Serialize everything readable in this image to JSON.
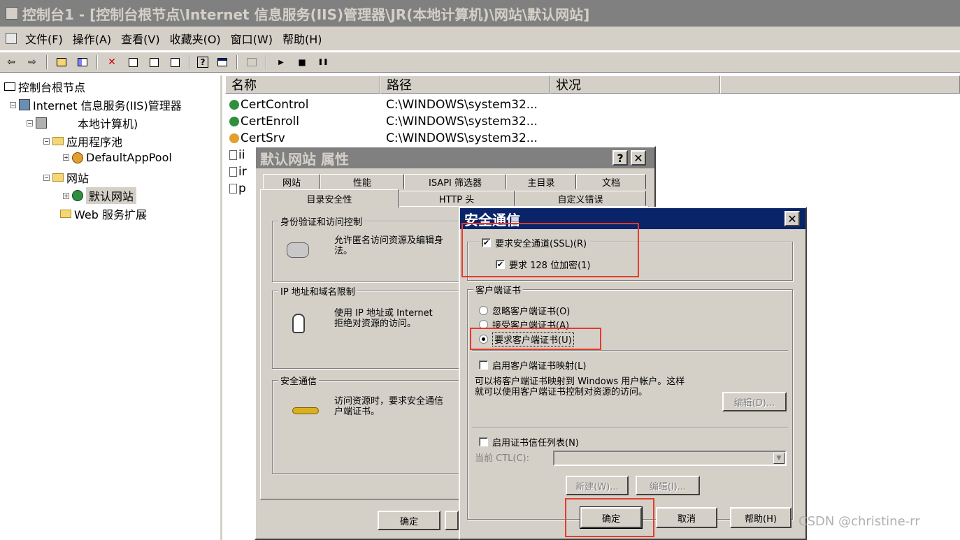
{
  "app": {
    "title": "控制台1 - [控制台根节点\\Internet 信息服务(IIS)管理器\\JR(本地计算机)\\网站\\默认网站]"
  },
  "menu": [
    "文件(F)",
    "操作(A)",
    "查看(V)",
    "收藏夹(O)",
    "窗口(W)",
    "帮助(H)"
  ],
  "toolbar": {
    "icons": [
      "back-icon",
      "forward-icon",
      "up-icon",
      "show-hide-tree-icon",
      "delete-icon",
      "properties-icon",
      "refresh-icon",
      "export-icon",
      "help-icon",
      "view-icon",
      "computer-icon",
      "play-icon",
      "stop-icon",
      "pause-icon"
    ],
    "glyphs": {
      "back": "⇦",
      "forward": "⇨",
      "delete": "✕",
      "help": "?",
      "play": "▶",
      "stop": "■",
      "pause": "❚❚"
    }
  },
  "tree": {
    "root": "控制台根节点",
    "iis": "Internet 信息服务(IIS)管理器",
    "computer": "本地计算机)",
    "apppools": "应用程序池",
    "defaultpool": "DefaultAppPool",
    "websites": "网站",
    "defaultsite": "默认网站",
    "webext": "Web 服务扩展",
    "plus": "+",
    "minus": "−"
  },
  "list": {
    "columns": [
      "名称",
      "路径",
      "状况"
    ],
    "rows": [
      {
        "name": "CertControl",
        "path": "C:\\WINDOWS\\system32..."
      },
      {
        "name": "CertEnroll",
        "path": "C:\\WINDOWS\\system32..."
      },
      {
        "name": "CertSrv",
        "path": "C:\\WINDOWS\\system32..."
      },
      {
        "name": "ii",
        "path": ""
      },
      {
        "name": "ir",
        "path": ""
      },
      {
        "name": "p",
        "path": ""
      }
    ]
  },
  "props": {
    "title": "默认网站 属性",
    "help_btn": "?",
    "close_btn": "✕",
    "tabs_back": [
      "网站",
      "性能",
      "ISAPI 筛选器",
      "主目录",
      "文档"
    ],
    "tabs_front": [
      "目录安全性",
      "HTTP 头",
      "自定义错误"
    ],
    "auth": {
      "label": "身份验证和访问控制",
      "text": "允许匿名访问资源及编辑身\n法。"
    },
    "ip": {
      "label": "IP 地址和域名限制",
      "text": "使用 IP 地址或 Internet\n拒绝对资源的访问。"
    },
    "secure": {
      "label": "安全通信",
      "text": "访问资源时，要求安全通信\n户端证书。"
    },
    "ok": "确定"
  },
  "secure": {
    "title": "安全通信",
    "close_btn": "✕",
    "check_mark": "✔",
    "require_ssl": "要求安全通道(SSL)(R)",
    "require_128": "要求 128 位加密(1)",
    "client_group": "客户端证书",
    "ignore": "忽略客户端证书(O)",
    "accept": "接受客户端证书(A)",
    "require": "要求客户端证书(U)",
    "enable_mapping": "启用客户端证书映射(L)",
    "mapping_desc": "可以将客户端证书映射到 Windows 用户帐户。这样\n就可以使用客户端证书控制对资源的访问。",
    "edit1": "编辑(D)...",
    "enable_ctl": "启用证书信任列表(N)",
    "current_ctl": "当前 CTL(C):",
    "dropdown_arrow": "▼",
    "new": "新建(W)...",
    "edit2": "编辑(I)...",
    "ok": "确定",
    "cancel": "取消",
    "help": "帮助(H)"
  },
  "watermark": "CSDN @christine-rr",
  "colors": {
    "highlight": "#e8392a",
    "active_title": "#0a246a",
    "face": "#d4d0c8"
  }
}
